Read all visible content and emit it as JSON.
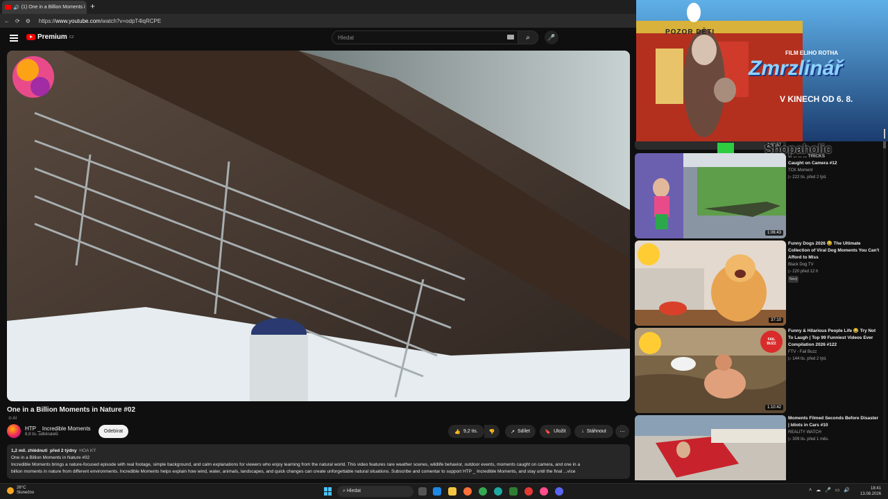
{
  "browser": {
    "tab_title": "(1) One in a Billion Moments i",
    "new_tab": "+",
    "url_prefix": "https://",
    "url_host": "www.youtube.com",
    "url_path": "/watch?v=odpT4lqRCPE"
  },
  "youtube": {
    "logo_text": "Premium",
    "logo_badge": "CZ",
    "search_placeholder": "Hledat"
  },
  "video": {
    "title": "One in a Billion Moments in Nature #02",
    "ai_badge": "AI",
    "channel_name": "HTP _ Incredible Moments",
    "subscribers": "8,9 tis. odběratelů",
    "subscribe_label": "Odebírat",
    "likes": "9,2 tis.",
    "share_label": "Sdílet",
    "save_label": "Uložit",
    "download_label": "Stáhnout",
    "more_label": "⋯",
    "views": "1,2 mil. zhlédnutí",
    "age": "před 2 týdny",
    "tag": "HOA KỲ",
    "desc_line1": "One in a Billion Moments in Nature #02",
    "desc_line2": "Incredible Moments brings a nature-focused episode with real footage, simple background, and calm explanations for viewers who enjoy learning from the natural world. This video features rare weather scenes, wildlife behavior, outdoor events, moments caught on camera, and one in a",
    "desc_line3": "billion moments in nature from different environments. Incredible Moments helps explain how wind, water, animals, landscapes, and quick changes can create unforgettable natural situations. Subscribe and comentar to support HTP _ Incredible Moments, and stay until the final",
    "desc_more": "...více"
  },
  "ad": {
    "sign": "POZOR DĚTI",
    "director": "FILM ELIHO ROTHA",
    "title": "Zmrzlinář",
    "release": "V KINECH OD 6. 8."
  },
  "recommendations": [
    {
      "partial_duration": "1:01:57",
      "title": "Caught on Camera #12",
      "title_partial": "... ... ... ... TRICKS",
      "channel": "TCK Moment",
      "meta": "▷ 222 tis.   před 2 týd.",
      "duration": "1:06:43"
    },
    {
      "title": "Funny Dogs 2026 😂 The Ultimate Collection of Viral Dog Moments You Can't Afford to Miss",
      "channel": "Black Dog TV",
      "meta": "▷ 220   před 12 h",
      "badge": "Nový",
      "duration": "37:10"
    },
    {
      "title": "Funny & Hilarious People Life 😂 Try Not To Laugh | Top 99 Funniest Videos Ever Compilation 2026 #122",
      "channel": "FTV - Fail Buzz",
      "meta": "▷ 144 tis.   před 2 týd.",
      "duration": "1:10:42",
      "logo": "FAIL BUZZ"
    },
    {
      "title": "Moments Filmed Seconds Before Disaster | Idiots in Cars #10",
      "channel": "REALITY WATCH",
      "meta": "▷ 309 tis.   před 1 měs."
    }
  ],
  "overlay_text": "Shopaholic",
  "taskbar": {
    "temp": "26°C",
    "weather": "Slunečno",
    "search": "Hledat",
    "time": "18:41",
    "date": "13.08.2026"
  }
}
